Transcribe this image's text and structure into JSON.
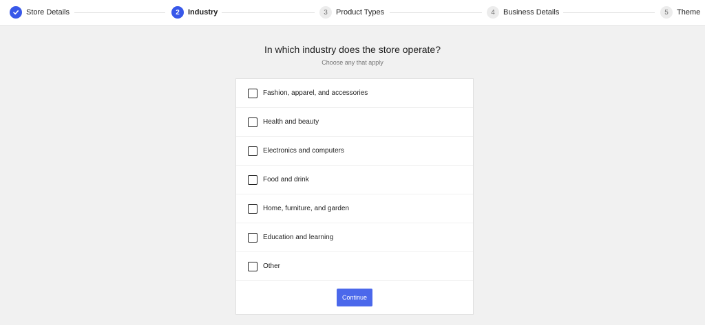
{
  "stepper": {
    "steps": [
      {
        "number": "",
        "label": "Store Details",
        "state": "done",
        "icon": "check-icon"
      },
      {
        "number": "2",
        "label": "Industry",
        "state": "active"
      },
      {
        "number": "3",
        "label": "Product Types",
        "state": "upcoming"
      },
      {
        "number": "4",
        "label": "Business Details",
        "state": "upcoming"
      },
      {
        "number": "5",
        "label": "Theme",
        "state": "upcoming"
      }
    ]
  },
  "main": {
    "title": "In which industry does the store operate?",
    "subtitle": "Choose any that apply",
    "options": [
      {
        "label": "Fashion, apparel, and accessories",
        "checked": false
      },
      {
        "label": "Health and beauty",
        "checked": false
      },
      {
        "label": "Electronics and computers",
        "checked": false
      },
      {
        "label": "Food and drink",
        "checked": false
      },
      {
        "label": "Home, furniture, and garden",
        "checked": false
      },
      {
        "label": "Education and learning",
        "checked": false
      },
      {
        "label": "Other",
        "checked": false
      }
    ],
    "continue_label": "Continue"
  },
  "colors": {
    "accent": "#3858e9",
    "background": "#f1f1f1",
    "card": "#ffffff"
  }
}
